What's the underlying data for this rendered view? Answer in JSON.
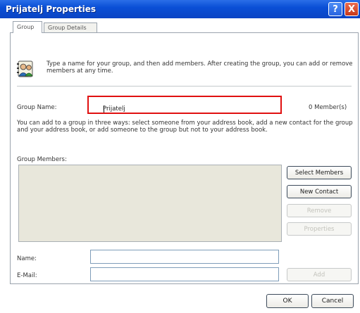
{
  "window": {
    "title": "Prijatelj Properties",
    "help_glyph": "?",
    "close_glyph": "X"
  },
  "tabs": [
    {
      "label": "Group",
      "active": true
    },
    {
      "label": "Group Details",
      "active": false
    }
  ],
  "intro": {
    "text": "Type a name for your group, and then add members. After creating the group, you can add or remove members at any time."
  },
  "group_name": {
    "label": "Group Name:",
    "value": "Prijatelj",
    "member_count": "0 Member(s)"
  },
  "description": "You can add to a group in three ways: select someone from your address book, add a new contact for the group and your address book, or add someone to the group but not to your address book.",
  "members": {
    "label": "Group Members:",
    "items": []
  },
  "buttons": {
    "select_members": "Select Members",
    "new_contact": "New Contact",
    "remove": "Remove",
    "properties": "Properties",
    "add": "Add",
    "ok": "OK",
    "cancel": "Cancel"
  },
  "fields": {
    "name_label": "Name:",
    "name_value": "",
    "email_label": "E-Mail:",
    "email_value": ""
  },
  "colors": {
    "titlebar": "#0a4fd6",
    "highlight_border": "#e01010",
    "list_background": "#e8e7db"
  }
}
